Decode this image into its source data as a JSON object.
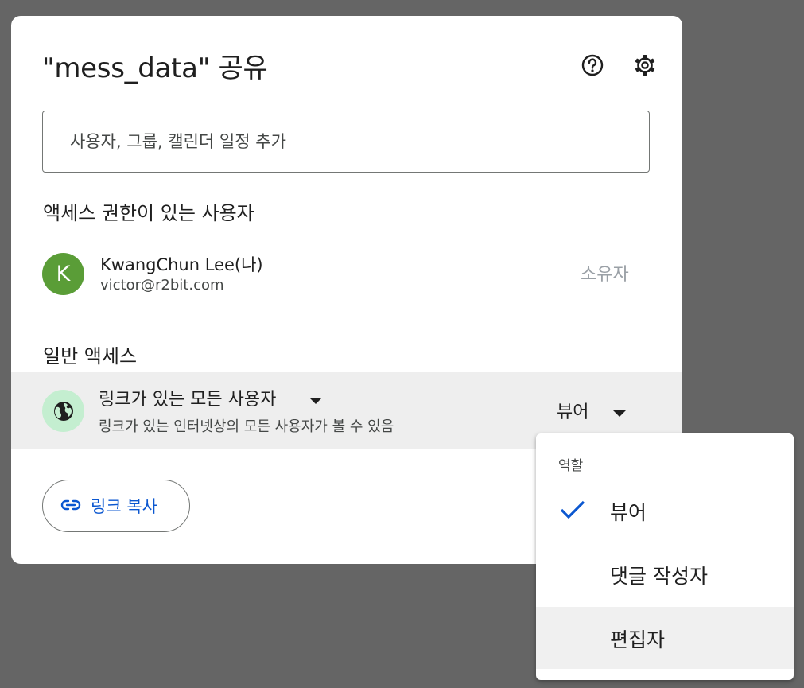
{
  "dialog": {
    "title": "\"mess_data\" 공유",
    "help_icon": "help-icon",
    "settings_icon": "gear-icon"
  },
  "search": {
    "placeholder": "사용자, 그룹, 캘린더 일정 추가"
  },
  "people_section": {
    "title": "액세스 권한이 있는 사용자",
    "users": [
      {
        "avatar_initial": "K",
        "avatar_color": "#5a9d37",
        "name": "KwangChun Lee(나)",
        "email": "victor@r2bit.com",
        "role": "소유자"
      }
    ]
  },
  "general_access": {
    "title": "일반 액세스",
    "icon": "globe-icon",
    "label": "링크가 있는 모든 사용자",
    "description": "링크가 있는 인터넷상의 모든 사용자가 볼 수 있음",
    "role": "뷰어"
  },
  "copy_link": {
    "label": "링크 복사",
    "icon": "link-icon"
  },
  "role_menu": {
    "heading": "역할",
    "items": [
      {
        "label": "뷰어",
        "selected": true
      },
      {
        "label": "댓글 작성자",
        "selected": false
      },
      {
        "label": "편집자",
        "selected": false
      }
    ]
  },
  "colors": {
    "backdrop": "#656565",
    "accent": "#0b57d0",
    "row_highlight": "#eeeeee"
  }
}
